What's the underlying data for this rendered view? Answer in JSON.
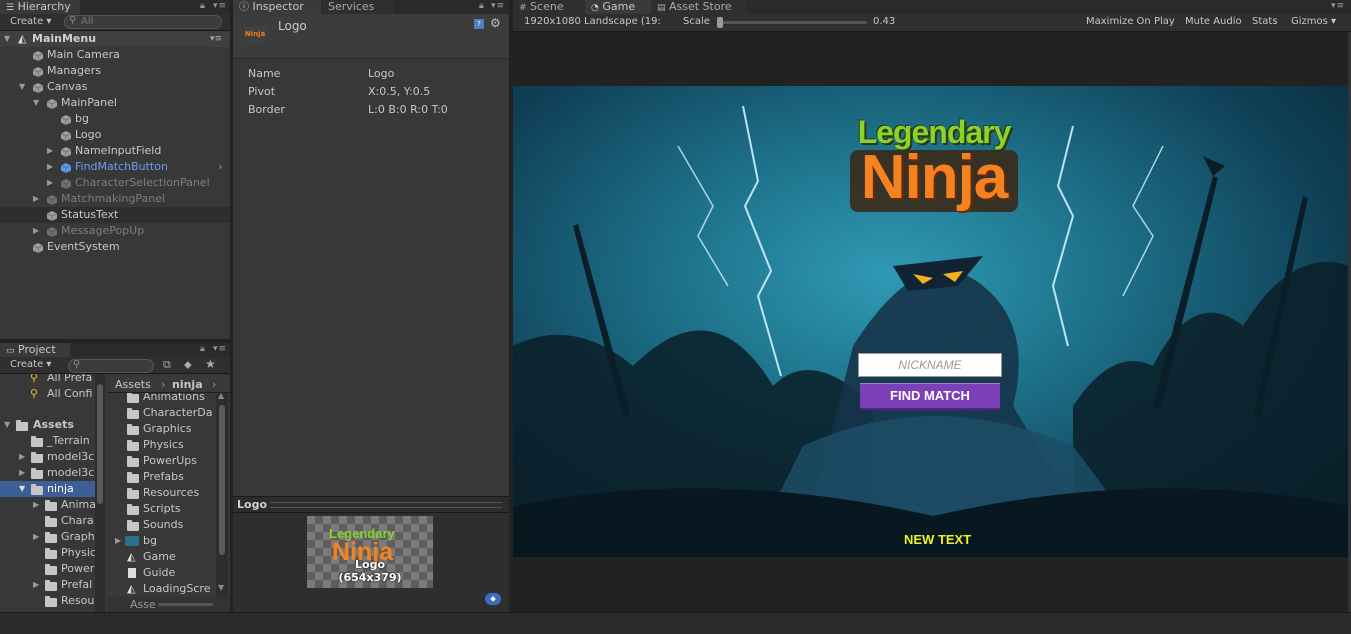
{
  "hierarchy": {
    "tab": "Hierarchy",
    "create": "Create",
    "search_placeholder": "All",
    "scene": "MainMenu",
    "items": [
      {
        "label": "Main Camera"
      },
      {
        "label": "Managers"
      },
      {
        "label": "Canvas"
      },
      {
        "label": "MainPanel"
      },
      {
        "label": "bg"
      },
      {
        "label": "Logo"
      },
      {
        "label": "NameInputField"
      },
      {
        "label": "FindMatchButton"
      },
      {
        "label": "CharacterSelectionPanel"
      },
      {
        "label": "MatchmakingPanel"
      },
      {
        "label": "StatusText"
      },
      {
        "label": "MessagePopUp"
      },
      {
        "label": "EventSystem"
      }
    ]
  },
  "inspector": {
    "tabs": [
      "Inspector",
      "Services"
    ],
    "object_name": "Logo",
    "icon_text": "Ninja",
    "props": [
      {
        "label": "Name",
        "value": "Logo"
      },
      {
        "label": "Pivot",
        "value": "X:0.5, Y:0.5"
      },
      {
        "label": "Border",
        "value": "L:0 B:0 R:0 T:0"
      }
    ],
    "preview_title": "Logo",
    "preview_name": "Logo",
    "preview_size": "(654x379)",
    "preview_logo_top": "Legendary",
    "preview_logo_bottom": "Ninja"
  },
  "project": {
    "tab": "Project",
    "create": "Create",
    "favorites": [
      "All Prefa",
      "All Confi"
    ],
    "tree": [
      {
        "label": "Assets"
      },
      {
        "label": "_Terrain"
      },
      {
        "label": "model3c"
      },
      {
        "label": "model3c"
      },
      {
        "label": "ninja"
      },
      {
        "label": "Anima"
      },
      {
        "label": "Chara"
      },
      {
        "label": "Graph"
      },
      {
        "label": "Physic"
      },
      {
        "label": "Power"
      },
      {
        "label": "Prefal"
      },
      {
        "label": "Resou"
      }
    ],
    "breadcrumb": [
      "Assets",
      "ninja"
    ],
    "files": [
      {
        "label": "Animations"
      },
      {
        "label": "CharacterDa"
      },
      {
        "label": "Graphics"
      },
      {
        "label": "Physics"
      },
      {
        "label": "PowerUps"
      },
      {
        "label": "Prefabs"
      },
      {
        "label": "Resources"
      },
      {
        "label": "Scripts"
      },
      {
        "label": "Sounds"
      },
      {
        "label": "bg"
      },
      {
        "label": "Game"
      },
      {
        "label": "Guide"
      },
      {
        "label": "LoadingScre"
      }
    ],
    "footer": "Asse"
  },
  "game": {
    "tabs": [
      "Scene",
      "Game",
      "Asset Store"
    ],
    "resolution": "1920x1080 Landscape (19:",
    "scale_label": "Scale",
    "scale_value": "0.43",
    "buttons": [
      "Maximize On Play",
      "Mute Audio",
      "Stats",
      "Gizmos"
    ],
    "logo_top": "Legendary",
    "logo_bottom": "Ninja",
    "nickname_placeholder": "NICKNAME",
    "find_match": "FIND MATCH",
    "status_text": "NEW TEXT"
  }
}
